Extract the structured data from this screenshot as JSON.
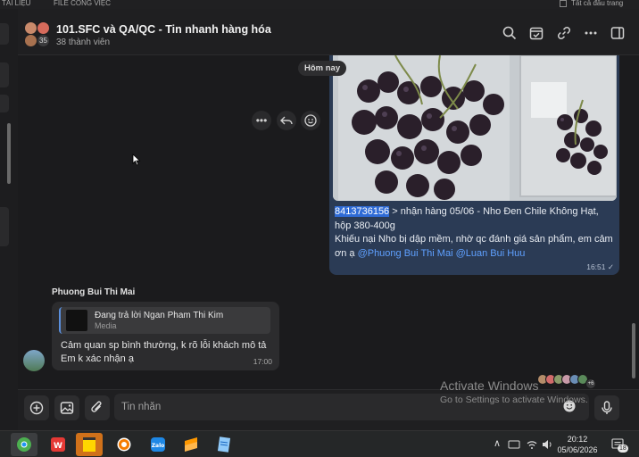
{
  "topstrip": {
    "left_label": "TÀI LIỆU",
    "mid_label": "FILE CÔNG VIỆC",
    "right_label": "Tất cả đầu trang"
  },
  "header": {
    "title": "101.SFC và QA/QC - Tin nhanh hàng hóa",
    "members": "38 thành viên",
    "avatar_count": "35",
    "icons": [
      "search-icon",
      "calendar-check-icon",
      "link-icon",
      "more-icon",
      "sidebar-toggle-icon"
    ]
  },
  "chat": {
    "day_label": "Hôm nay",
    "outgoing": {
      "ticket": "8413736156",
      "line1": " > nhận hàng 05/06 - Nho Đen Chile Không Hạt, hộp 380-400g",
      "line2": "Khiếu nại      Nho bị dập mềm, nhờ qc đánh giá sản phẩm, em cảm ơn ạ ",
      "mention1": "@Phuong Bui Thi Mai",
      "mention2": "@Luan Bui Huu",
      "time": "16:51"
    },
    "incoming": {
      "sender": "Phuong Bui Thi Mai",
      "quote_title": "Đang trả lời Ngan Pham Thi Kim",
      "quote_sub": "Media",
      "text_line1": "Cảm quan sp bình thường, k rõ lỗi khách mô tả",
      "text_line2": "Em k xác nhận ạ",
      "time": "17:00"
    },
    "reader_count": "+6"
  },
  "composer": {
    "placeholder": "Tin nhắn"
  },
  "watermark": {
    "line1": "Activate Windows",
    "line2": "Go to Settings to activate Windows."
  },
  "taskbar": {
    "time": "20:12",
    "date": "05/06/2026",
    "notif_count": "18"
  },
  "colors": {
    "bubble_out": "#2b3b55",
    "bubble_in": "#2c2c2e",
    "mention": "#5fa0ff",
    "selection": "#2f6bd6"
  }
}
